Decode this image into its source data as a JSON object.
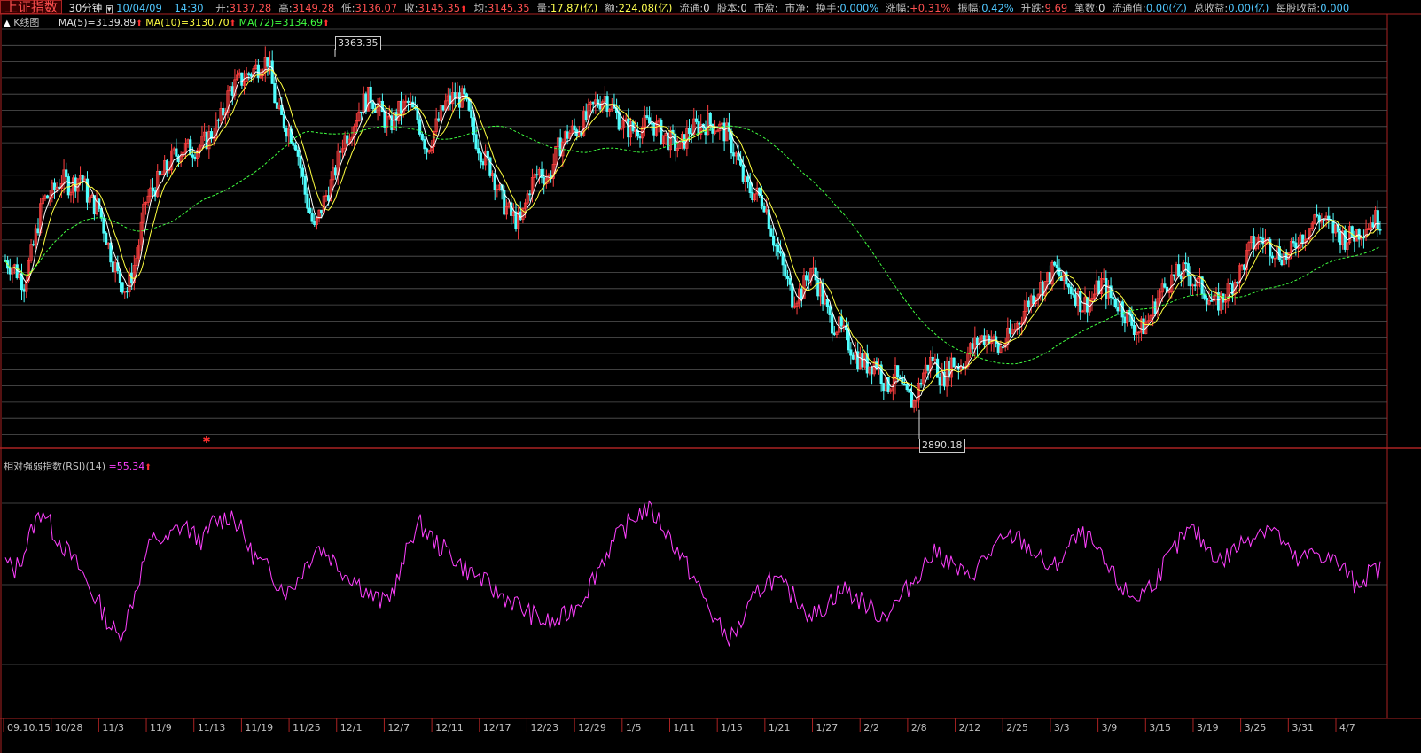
{
  "header": {
    "index_name": "上证指数",
    "period": "30分钟",
    "date": "10/04/09",
    "time": "14:30",
    "fields": [
      {
        "label": "开:",
        "value": "3137.28",
        "color": "red"
      },
      {
        "label": "高:",
        "value": "3149.28",
        "color": "red"
      },
      {
        "label": "低:",
        "value": "3136.07",
        "color": "red"
      },
      {
        "label": "收:",
        "value": "3145.35",
        "color": "red",
        "arrow": true
      },
      {
        "label": "均:",
        "value": "3145.35",
        "color": "red"
      },
      {
        "label": "量:",
        "value": "17.87(亿)",
        "color": "yellow"
      },
      {
        "label": "额:",
        "value": "224.08(亿)",
        "color": "yellow"
      },
      {
        "label": "流通:",
        "value": "0",
        "color": "white"
      },
      {
        "label": "股本:",
        "value": "0",
        "color": "white"
      },
      {
        "label": "市盈:",
        "value": "",
        "color": "white"
      },
      {
        "label": "市净:",
        "value": "",
        "color": "white"
      },
      {
        "label": "换手:",
        "value": "0.000%",
        "color": "cyan"
      },
      {
        "label": "涨幅:",
        "value": "+0.31%",
        "color": "red"
      },
      {
        "label": "振幅:",
        "value": "0.42%",
        "color": "cyan"
      },
      {
        "label": "升跌:",
        "value": "9.69",
        "color": "red"
      },
      {
        "label": "笔数:",
        "value": "0",
        "color": "white"
      },
      {
        "label": "流通值:",
        "value": "0.00(亿)",
        "color": "cyan"
      },
      {
        "label": "总收益:",
        "value": "0.00(亿)",
        "color": "cyan"
      },
      {
        "label": "每股收益:",
        "value": "0.000",
        "color": "cyan"
      }
    ]
  },
  "main_legend": {
    "title": "K线图",
    "ma5": "MA(5)=3139.89",
    "ma10": "MA(10)=3130.70",
    "ma72": "MA(72)=3134.69"
  },
  "rsi_legend": {
    "title": "相对强弱指数(RSI)(14)",
    "value": "=55.34"
  },
  "annotations": {
    "high_label": "3363.35",
    "low_label": "2890.18"
  },
  "colors": {
    "up": "#ff4040",
    "down": "#50ffff",
    "ma5": "#ffffff",
    "ma10": "#ffff40",
    "ma72": "#40ff40",
    "rsi": "#ff40ff",
    "grid": "#555555",
    "axis_text": "#c0c0c0"
  },
  "chart_data": [
    {
      "type": "line",
      "subtype": "candlestick",
      "title": "上证指数 30分钟",
      "x_ticks": [
        "09.10.15",
        "10/28",
        "11/3",
        "11/9",
        "11/13",
        "11/19",
        "11/25",
        "12/1",
        "12/7",
        "12/11",
        "12/17",
        "12/23",
        "12/29",
        "1/5",
        "1/11",
        "1/15",
        "1/21",
        "1/27",
        "2/2",
        "2/8",
        "2/12",
        "2/25",
        "3/3",
        "3/9",
        "3/15",
        "3/19",
        "3/25",
        "3/31",
        "4/7"
      ],
      "ylim": [
        2840,
        3400
      ],
      "grid": true,
      "high": 3363.35,
      "low": 2890.18,
      "series": [
        {
          "name": "MA(5)",
          "last": 3139.89
        },
        {
          "name": "MA(10)",
          "last": 3130.7
        },
        {
          "name": "MA(72)",
          "last": 3134.69
        }
      ],
      "close_path": [
        3090,
        3080,
        3060,
        3110,
        3170,
        3180,
        3200,
        3190,
        3205,
        3170,
        3160,
        3110,
        3070,
        3050,
        3095,
        3170,
        3190,
        3210,
        3230,
        3240,
        3240,
        3245,
        3260,
        3280,
        3320,
        3330,
        3340,
        3350,
        3360,
        3290,
        3270,
        3250,
        3180,
        3130,
        3170,
        3200,
        3250,
        3270,
        3300,
        3310,
        3290,
        3270,
        3290,
        3300,
        3280,
        3240,
        3270,
        3300,
        3310,
        3305,
        3260,
        3230,
        3210,
        3170,
        3150,
        3140,
        3190,
        3210,
        3200,
        3240,
        3260,
        3265,
        3280,
        3300,
        3310,
        3290,
        3270,
        3265,
        3270,
        3275,
        3260,
        3250,
        3240,
        3265,
        3270,
        3275,
        3270,
        3260,
        3230,
        3190,
        3180,
        3170,
        3120,
        3080,
        3040,
        3050,
        3080,
        3050,
        3010,
        3000,
        2980,
        2960,
        2950,
        2955,
        2920,
        2935,
        2910,
        2900,
        2940,
        2960,
        2930,
        2955,
        2950,
        2970,
        2985,
        2990,
        2970,
        2985,
        3005,
        3030,
        3050,
        3060,
        3080,
        3060,
        3050,
        3030,
        3040,
        3060,
        3040,
        3030,
        3010,
        2995,
        3010,
        3040,
        3060,
        3070,
        3075,
        3060,
        3050,
        3030,
        3040,
        3060,
        3080,
        3110,
        3120,
        3110,
        3100,
        3095,
        3120,
        3130,
        3150,
        3140,
        3130,
        3120,
        3125,
        3135,
        3145
      ]
    },
    {
      "type": "line",
      "title": "相对强弱指数(RSI)(14)",
      "ylim": [
        0,
        100
      ],
      "grid": true,
      "series": [
        {
          "name": "RSI(14)",
          "last": 55.34
        }
      ],
      "values": [
        58,
        55,
        62,
        72,
        78,
        70,
        65,
        60,
        55,
        48,
        42,
        35,
        30,
        38,
        50,
        62,
        68,
        65,
        70,
        72,
        68,
        66,
        73,
        74,
        76,
        70,
        62,
        58,
        55,
        50,
        47,
        52,
        58,
        64,
        62,
        58,
        54,
        52,
        48,
        45,
        43,
        47,
        55,
        68,
        72,
        68,
        64,
        62,
        58,
        55,
        53,
        50,
        47,
        45,
        43,
        40,
        38,
        36,
        35,
        37,
        40,
        44,
        50,
        57,
        63,
        68,
        72,
        76,
        78,
        75,
        70,
        64,
        58,
        52,
        45,
        38,
        32,
        30,
        35,
        42,
        48,
        52,
        50,
        47,
        44,
        40,
        38,
        42,
        46,
        48,
        45,
        43,
        40,
        38,
        41,
        45,
        50,
        55,
        60,
        62,
        58,
        55,
        52,
        56,
        60,
        64,
        66,
        68,
        65,
        62,
        58,
        55,
        60,
        65,
        68,
        66,
        60,
        55,
        50,
        46,
        45,
        48,
        52,
        58,
        63,
        68,
        70,
        65,
        62,
        58,
        62,
        65,
        68,
        70,
        72,
        68,
        62,
        58,
        60,
        62,
        60,
        58,
        55,
        50,
        52,
        55
      ]
    }
  ]
}
